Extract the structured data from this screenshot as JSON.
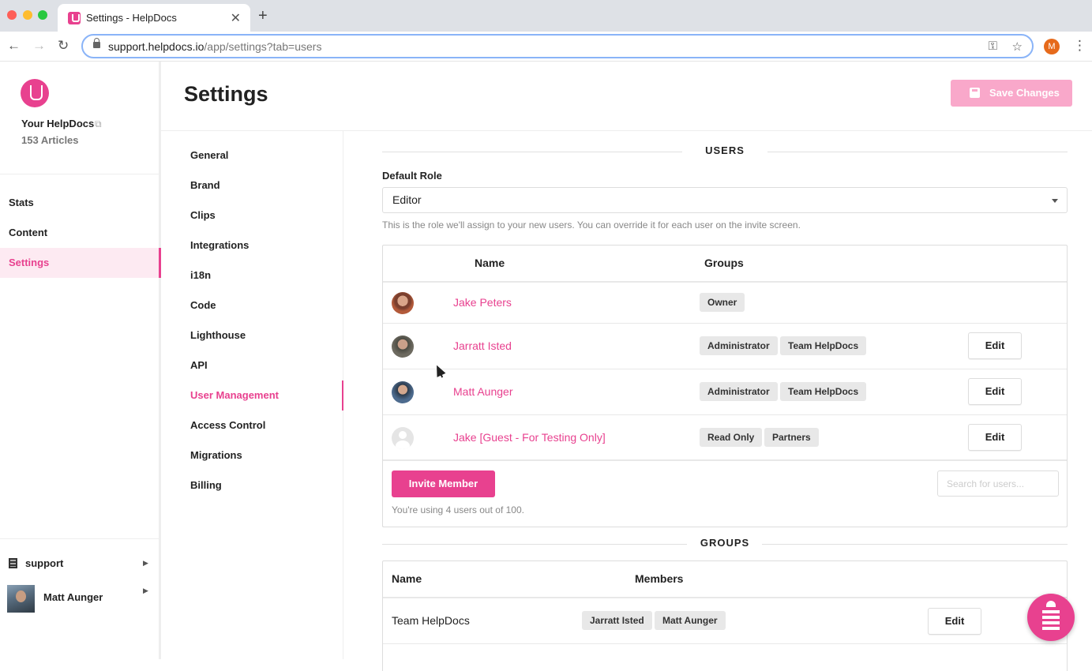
{
  "browser": {
    "tab_title": "Settings - HelpDocs",
    "url_host": "support.helpdocs.io",
    "url_path": "/app/settings?tab=users",
    "profile_initial": "M"
  },
  "sidebar": {
    "kb_name": "Your HelpDocs",
    "article_count": "153 Articles",
    "items": [
      {
        "label": "Stats",
        "active": false
      },
      {
        "label": "Content",
        "active": false
      },
      {
        "label": "Settings",
        "active": true
      }
    ],
    "org": "support",
    "user": "Matt Aunger"
  },
  "header": {
    "title": "Settings",
    "save_label": "Save Changes"
  },
  "settings_nav": [
    "General",
    "Brand",
    "Clips",
    "Integrations",
    "i18n",
    "Code",
    "Lighthouse",
    "API",
    "User Management",
    "Access Control",
    "Migrations",
    "Billing"
  ],
  "settings_nav_active": "User Management",
  "users": {
    "section_title": "USERS",
    "default_role_label": "Default Role",
    "default_role_value": "Editor",
    "help_text": "This is the role we'll assign to your new users. You can override it for each user on the invite screen.",
    "columns": [
      "Name",
      "Groups"
    ],
    "rows": [
      {
        "name": "Jake Peters",
        "groups": [
          "Owner"
        ],
        "editable": false
      },
      {
        "name": "Jarratt Isted",
        "groups": [
          "Administrator",
          "Team HelpDocs"
        ],
        "editable": true
      },
      {
        "name": "Matt Aunger",
        "groups": [
          "Administrator",
          "Team HelpDocs"
        ],
        "editable": true
      },
      {
        "name": "Jake [Guest - For Testing Only]",
        "groups": [
          "Read Only",
          "Partners"
        ],
        "editable": true
      }
    ],
    "edit_label": "Edit",
    "invite_label": "Invite Member",
    "search_placeholder": "Search for users...",
    "usage_text": "You're using 4 users out of 100."
  },
  "groups": {
    "section_title": "GROUPS",
    "columns": [
      "Name",
      "Members"
    ],
    "rows": [
      {
        "name": "Team HelpDocs",
        "members": [
          "Jarratt Isted",
          "Matt Aunger"
        ]
      }
    ],
    "edit_label": "Edit"
  },
  "colors": {
    "accent": "#e8418f",
    "accent_light": "#f9a8ca",
    "active_bg": "#fdeaf2"
  }
}
